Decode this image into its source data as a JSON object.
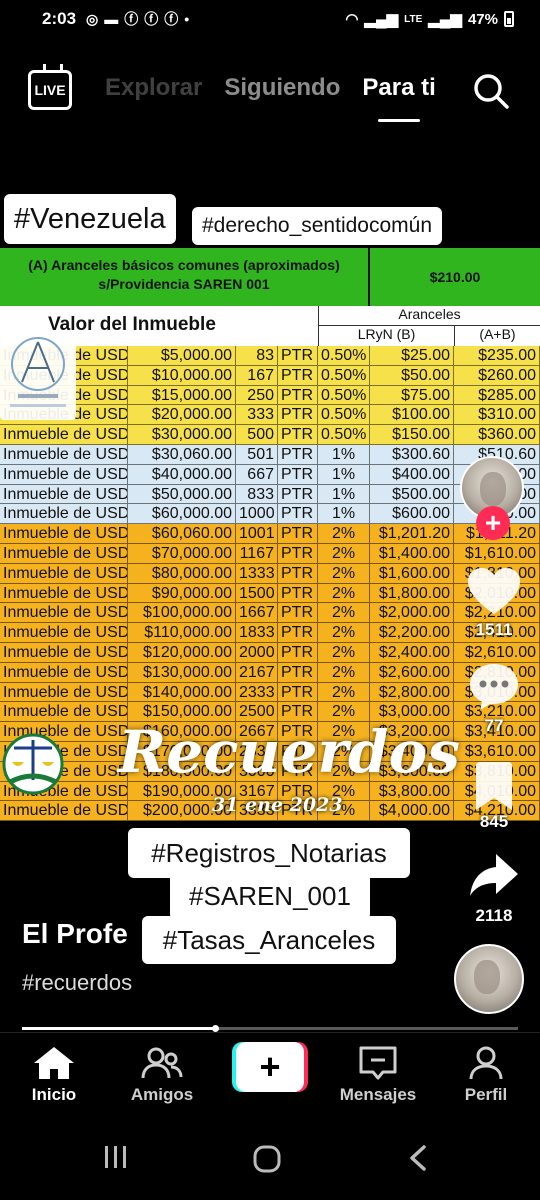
{
  "status_bar": {
    "time": "2:03",
    "network": "LTE",
    "battery": "47%"
  },
  "top_nav": {
    "live_label": "LIVE",
    "tabs": [
      {
        "label": "Explorar"
      },
      {
        "label": "Siguiendo"
      },
      {
        "label": "Para ti"
      }
    ]
  },
  "video": {
    "overlay_tags": [
      "#Venezuela",
      "#derecho_sentidocomún"
    ],
    "table": {
      "section_title": "(A) Aranceles básicos comunes (aproximados) s/Providencia SAREN 001",
      "section_value": "$210.00",
      "col_valor": "Valor del Inmueble",
      "col_aranceles": "Aranceles",
      "col_lryn": "LRyN (B)",
      "col_ab": "(A+B)",
      "rows": [
        {
          "label": "Inmueble de USD",
          "usd": "$5,000.00",
          "ptr": "83",
          "unit": "PTR",
          "pct": "0.50%",
          "b": "$25.00",
          "ab": "$235.00",
          "band": "yellow"
        },
        {
          "label": "Inmueble de USD",
          "usd": "$10,000.00",
          "ptr": "167",
          "unit": "PTR",
          "pct": "0.50%",
          "b": "$50.00",
          "ab": "$260.00",
          "band": "yellow"
        },
        {
          "label": "Inmueble de USD",
          "usd": "$15,000.00",
          "ptr": "250",
          "unit": "PTR",
          "pct": "0.50%",
          "b": "$75.00",
          "ab": "$285.00",
          "band": "yellow"
        },
        {
          "label": "Inmueble de USD",
          "usd": "$20,000.00",
          "ptr": "333",
          "unit": "PTR",
          "pct": "0.50%",
          "b": "$100.00",
          "ab": "$310.00",
          "band": "yellow"
        },
        {
          "label": "Inmueble de USD",
          "usd": "$30,000.00",
          "ptr": "500",
          "unit": "PTR",
          "pct": "0.50%",
          "b": "$150.00",
          "ab": "$360.00",
          "band": "yellow"
        },
        {
          "label": "Inmueble de USD",
          "usd": "$30,060.00",
          "ptr": "501",
          "unit": "PTR",
          "pct": "1%",
          "b": "$300.60",
          "ab": "$510.60",
          "band": "blue"
        },
        {
          "label": "Inmueble de USD",
          "usd": "$40,000.00",
          "ptr": "667",
          "unit": "PTR",
          "pct": "1%",
          "b": "$400.00",
          "ab": "$610.00",
          "band": "blue"
        },
        {
          "label": "Inmueble de USD",
          "usd": "$50,000.00",
          "ptr": "833",
          "unit": "PTR",
          "pct": "1%",
          "b": "$500.00",
          "ab": "$710.00",
          "band": "blue"
        },
        {
          "label": "Inmueble de USD",
          "usd": "$60,000.00",
          "ptr": "1000",
          "unit": "PTR",
          "pct": "1%",
          "b": "$600.00",
          "ab": "$810.00",
          "band": "blue"
        },
        {
          "label": "Inmueble de USD",
          "usd": "$60,060.00",
          "ptr": "1001",
          "unit": "PTR",
          "pct": "2%",
          "b": "$1,201.20",
          "ab": "$1,411.20",
          "band": "orange"
        },
        {
          "label": "Inmueble de USD",
          "usd": "$70,000.00",
          "ptr": "1167",
          "unit": "PTR",
          "pct": "2%",
          "b": "$1,400.00",
          "ab": "$1,610.00",
          "band": "orange"
        },
        {
          "label": "Inmueble de USD",
          "usd": "$80,000.00",
          "ptr": "1333",
          "unit": "PTR",
          "pct": "2%",
          "b": "$1,600.00",
          "ab": "$1,810.00",
          "band": "orange"
        },
        {
          "label": "Inmueble de USD",
          "usd": "$90,000.00",
          "ptr": "1500",
          "unit": "PTR",
          "pct": "2%",
          "b": "$1,800.00",
          "ab": "$2,010.00",
          "band": "orange"
        },
        {
          "label": "Inmueble de USD",
          "usd": "$100,000.00",
          "ptr": "1667",
          "unit": "PTR",
          "pct": "2%",
          "b": "$2,000.00",
          "ab": "$2,210.00",
          "band": "orange"
        },
        {
          "label": "Inmueble de USD",
          "usd": "$110,000.00",
          "ptr": "1833",
          "unit": "PTR",
          "pct": "2%",
          "b": "$2,200.00",
          "ab": "$2,410.00",
          "band": "orange"
        },
        {
          "label": "Inmueble de USD",
          "usd": "$120,000.00",
          "ptr": "2000",
          "unit": "PTR",
          "pct": "2%",
          "b": "$2,400.00",
          "ab": "$2,610.00",
          "band": "orange"
        },
        {
          "label": "Inmueble de USD",
          "usd": "$130,000.00",
          "ptr": "2167",
          "unit": "PTR",
          "pct": "2%",
          "b": "$2,600.00",
          "ab": "$2,810.00",
          "band": "orange"
        },
        {
          "label": "Inmueble de USD",
          "usd": "$140,000.00",
          "ptr": "2333",
          "unit": "PTR",
          "pct": "2%",
          "b": "$2,800.00",
          "ab": "$3,010.00",
          "band": "orange"
        },
        {
          "label": "Inmueble de USD",
          "usd": "$150,000.00",
          "ptr": "2500",
          "unit": "PTR",
          "pct": "2%",
          "b": "$3,000.00",
          "ab": "$3,210.00",
          "band": "orange"
        },
        {
          "label": "Inmueble de USD",
          "usd": "$160,000.00",
          "ptr": "2667",
          "unit": "PTR",
          "pct": "2%",
          "b": "$3,200.00",
          "ab": "$3,410.00",
          "band": "orange"
        },
        {
          "label": "Inmueble de USD",
          "usd": "$170,000.00",
          "ptr": "2833",
          "unit": "PTR",
          "pct": "2%",
          "b": "$3,400.00",
          "ab": "$3,610.00",
          "band": "orange"
        },
        {
          "label": "Inmueble de USD",
          "usd": "$180,000.00",
          "ptr": "3000",
          "unit": "PTR",
          "pct": "2%",
          "b": "$3,600.00",
          "ab": "$3,810.00",
          "band": "orange"
        },
        {
          "label": "Inmueble de USD",
          "usd": "$190,000.00",
          "ptr": "3167",
          "unit": "PTR",
          "pct": "2%",
          "b": "$3,800.00",
          "ab": "$4,010.00",
          "band": "orange"
        },
        {
          "label": "Inmueble de USD",
          "usd": "$200,000.00",
          "ptr": "3333",
          "unit": "PTR",
          "pct": "2%",
          "b": "$4,000.00",
          "ab": "$4,210.00",
          "band": "orange"
        }
      ]
    },
    "overlay_title": "Recuerdos",
    "overlay_date": "31 ene 2023"
  },
  "actions": {
    "likes": "1511",
    "comments": "77",
    "saves": "845",
    "shares": "2118"
  },
  "caption": {
    "tags": [
      "#Registros_Notarias",
      "#SAREN_001",
      "#Tasas_Aranceles"
    ],
    "author": "El Profe",
    "hashtag": "#recuerdos",
    "progress": 0.39
  },
  "bottom_nav": {
    "items": [
      {
        "label": "Inicio"
      },
      {
        "label": "Amigos"
      },
      {
        "label": "Mensajes"
      },
      {
        "label": "Perfil"
      }
    ],
    "create_label": "+"
  },
  "colors": {
    "accent_red": "#fe2c55",
    "accent_cyan": "#25f4ee",
    "header_green": "#31b51f",
    "band_yellow": "#f7e14a",
    "band_blue": "#d9e8f5",
    "band_orange": "#f5b21e"
  }
}
